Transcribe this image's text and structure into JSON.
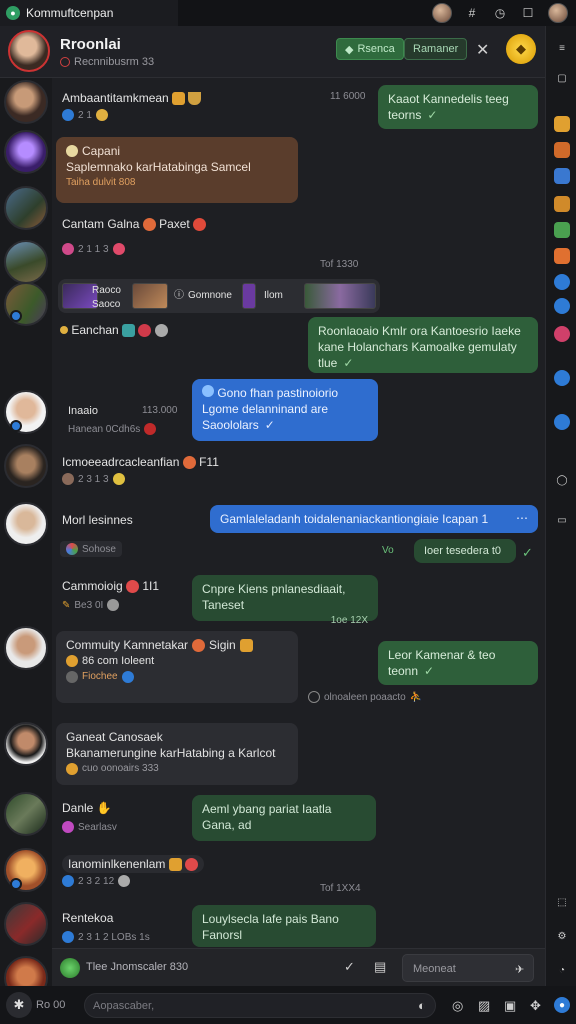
{
  "titlebar": {
    "title": "Kommuftcenpan",
    "icons": [
      "hash-icon",
      "clock-icon",
      "square-icon"
    ]
  },
  "header": {
    "title": "Rroonlai",
    "subtitle": "Recnnibusrm 33",
    "button_primary": "Rsenca",
    "button_secondary": "Ramaner",
    "close": "✕"
  },
  "messages": [
    {
      "name": "Ambaantitamkmean",
      "meta": "2 1",
      "time": "11 6000",
      "reply": "Kaaot Kannedelis teeg teorns"
    },
    {
      "name": "Capani",
      "text": "Saplemnako karHatabinga Samcel",
      "sub": "Taiha dulvit 808"
    },
    {
      "name": "Cantam Galna",
      "reaction": "Paxet",
      "meta": "2 1 1 3",
      "time": "Tof 1330"
    },
    {
      "media_1": "Raoco",
      "media_2": "Saoco",
      "media_3": "Gomnone",
      "media_4": "Ilom"
    },
    {
      "name": "Eanchan",
      "reply": "Roonlaoaio Kmlr ora Kantoesrio Iaeke kane Holanchars Kamoalke gemulaty tlue"
    },
    {
      "name": "Inaaio",
      "time": "113.000",
      "meta": "Hanean 0Cdh6s",
      "blue": "Gono fhan pastinoiorio Lgome delanninand are Saoololars"
    },
    {
      "name": "Icmoeeadrcacleanfian",
      "reaction": "F11",
      "meta": "2 3 1 3"
    },
    {
      "name": "Morl lesinnes",
      "meta": "Sohose",
      "blue_bar": "Gamlaleladanh toidalenaniackantiongiaie Icapan 1",
      "check": "Vo",
      "reply2": "Ioer tesedera t0"
    },
    {
      "name": "Cammoioig",
      "reaction": "1I1",
      "meta": "Be3 0I",
      "card": "Cnpre Kiens pnlanesdiaait, Taneset",
      "time": "1oe 12X"
    },
    {
      "name": "Commuity Kamnetakar",
      "tag": "Sigin",
      "meta": "86 com Ioleent",
      "meta2": "Fiochee",
      "reply": "Leor Kamenar & teo teonn",
      "time": "olnoaleen poaacto"
    },
    {
      "name": "Ganeat Canosaek",
      "text": "Bkanamerungine karHatabing a Karlcot",
      "sub": "cuo oonoairs 333"
    },
    {
      "name": "Danle",
      "sub": "Searlasv",
      "reply": "Aeml ybang pariat Iaatla Gana, ad"
    },
    {
      "name": "Ianominlkenenlam",
      "meta": "2 3 2 12",
      "time": "Tof 1XX4"
    },
    {
      "name": "Rentekoa",
      "meta": "2 3 1 2 LOBs 1s",
      "reply": "Louylsecla Iafe pais Bano Fanorsl"
    }
  ],
  "composer": {
    "label": "Tlee Jnomscaler 830",
    "placeholder": "Meoneat"
  },
  "bottombar": {
    "left": "Ro 00",
    "search": "Aopascaber,"
  }
}
